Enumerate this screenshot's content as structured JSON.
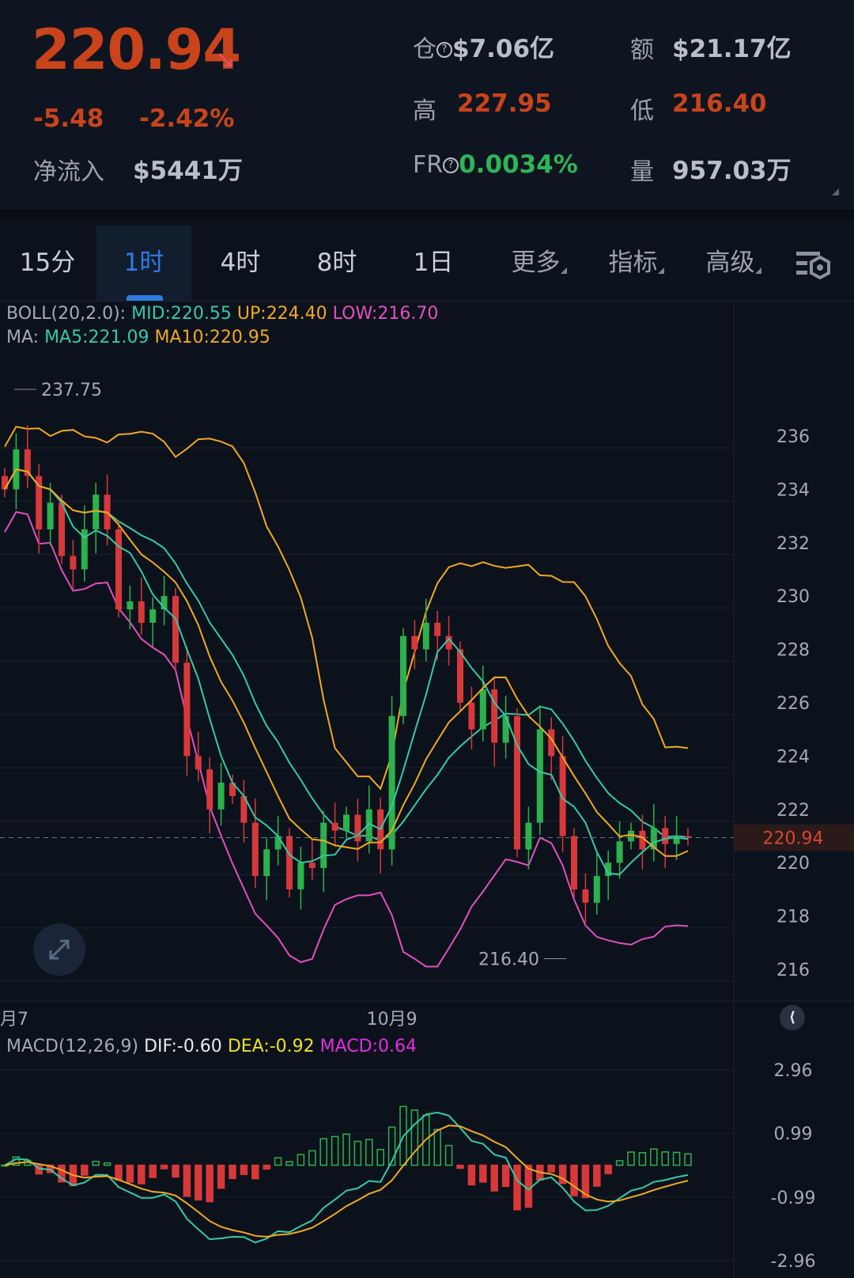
{
  "header": {
    "last_price": "220.94",
    "trend_icon": "arrow-down-right-icon",
    "change": "-5.48",
    "change_pct": "-2.42%",
    "net_inflow_label": "净流入",
    "net_inflow": "$5441万",
    "oi_label": "仓",
    "oi": "$7.06亿",
    "turnover_label": "额",
    "turnover": "$21.17亿",
    "high_label": "高",
    "high": "227.95",
    "low_label": "低",
    "low": "216.40",
    "fr_label": "FR",
    "fr": "0.0034%",
    "volume_label": "量",
    "volume": "957.03万"
  },
  "tabs": [
    {
      "label": "15分"
    },
    {
      "label": "1时",
      "active": true
    },
    {
      "label": "4时"
    },
    {
      "label": "8时"
    },
    {
      "label": "1日"
    },
    {
      "label": "更多"
    },
    {
      "label": "指标"
    },
    {
      "label": "高级"
    }
  ],
  "legend": {
    "boll_prefix": "BOLL(20,2.0):",
    "boll_mid": "MID:220.55",
    "boll_up": "UP:224.40",
    "boll_low": "LOW:216.70",
    "ma_prefix": "MA:",
    "ma5": "MA5:221.09",
    "ma10": "MA10:220.95",
    "macd_prefix": "MACD(12,26,9)",
    "dif": "DIF:-0.60",
    "dea": "DEA:-0.92",
    "macd": "MACD:0.64"
  },
  "colors": {
    "up": "#2bb24c",
    "down": "#d8383a",
    "mid": "#33c9a8",
    "upper": "#f0a91e",
    "lower": "#e24fc0",
    "ma5": "#33c9a8",
    "ma10": "#f0a91e"
  },
  "chart_data": {
    "type": "candlestick",
    "price_axis": [
      "236",
      "234",
      "232",
      "230",
      "228",
      "226",
      "224",
      "222",
      "220",
      "218",
      "216"
    ],
    "ylim": [
      215.5,
      238
    ],
    "x_labels": [
      {
        "label": "月7",
        "index": 0
      },
      {
        "label": "10月9",
        "index": 34
      }
    ],
    "max_label": "237.75",
    "min_label": "216.40",
    "current_price": "220.94",
    "closes": [
      234,
      235.5,
      234.5,
      232.5,
      233.5,
      231.5,
      231,
      232.5,
      233.8,
      232.5,
      229.5,
      229.8,
      229,
      229.5,
      230,
      227.5,
      224,
      223.5,
      222,
      223,
      222.5,
      221.5,
      219.5,
      220.5,
      221,
      219,
      220,
      219.8,
      221.5,
      221.2,
      221.8,
      220.8,
      222,
      220.5,
      225.5,
      228.5,
      228,
      229,
      228.5,
      228,
      226,
      225,
      226.5,
      224.5,
      225.5,
      220.5,
      221.5,
      225,
      224,
      221,
      219,
      218.5,
      219.5,
      220,
      220.8,
      221.2,
      220.5,
      221.3,
      220.7,
      221.0,
      220.94
    ],
    "macd_axis": [
      "2.96",
      "0.99",
      "-0.99",
      "-2.96"
    ],
    "macd_ylim": [
      -2.96,
      2.96
    ]
  }
}
